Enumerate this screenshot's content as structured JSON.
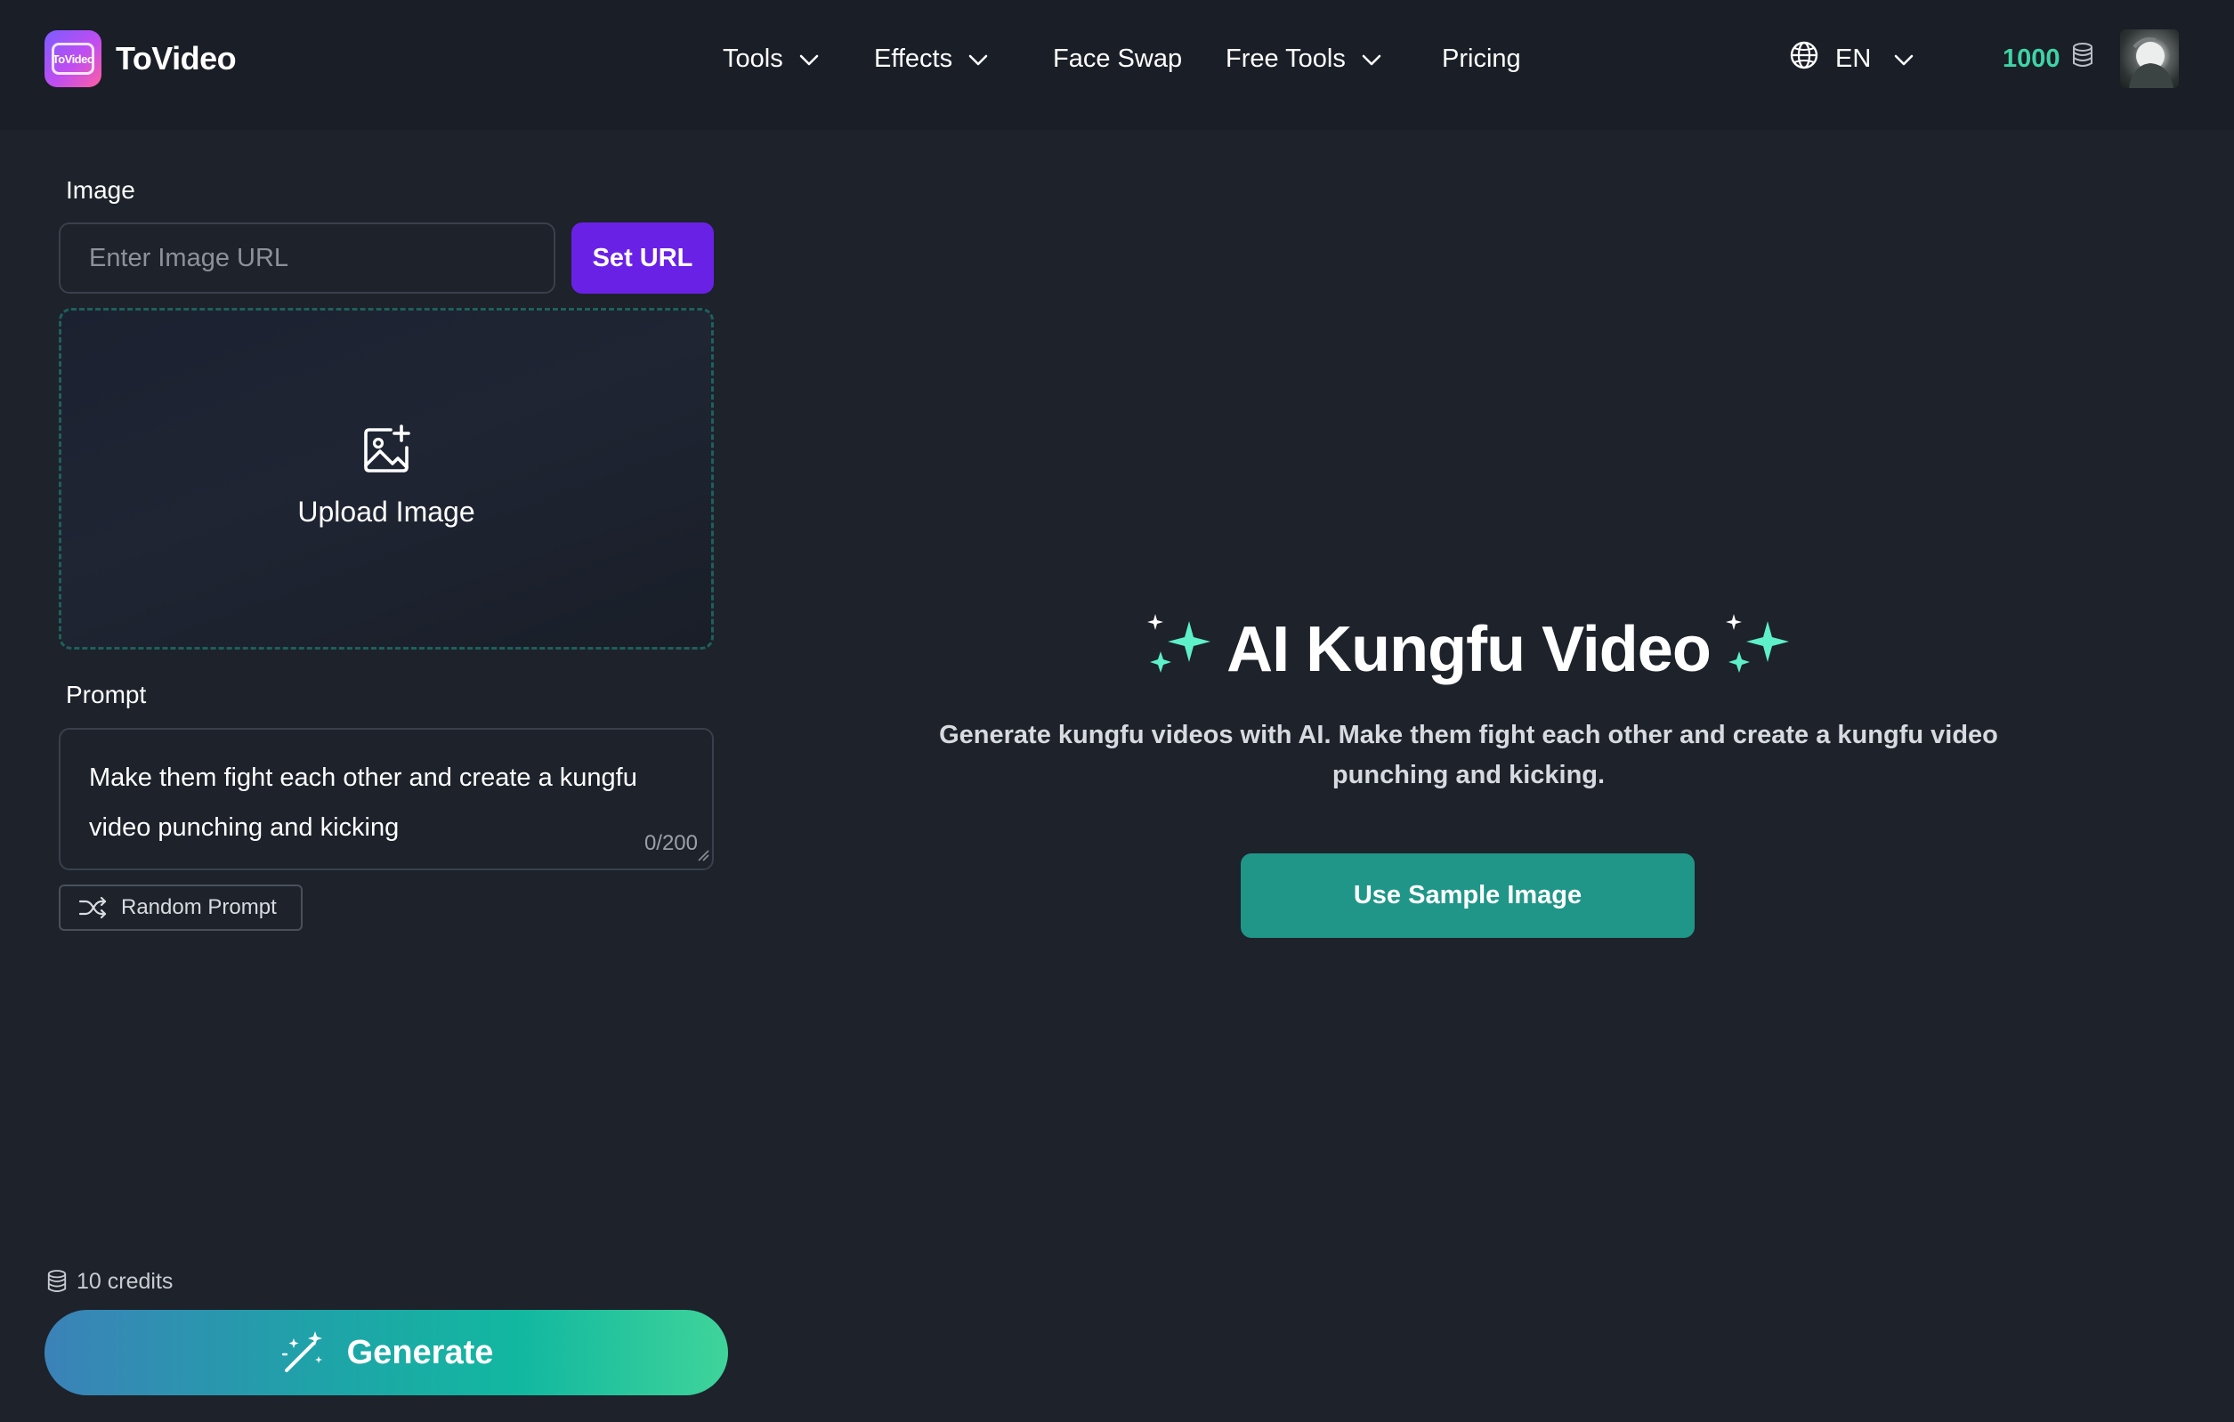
{
  "header": {
    "logo_text": "ToVideo",
    "brand": "ToVideo",
    "nav": [
      {
        "label": "Tools",
        "has_dropdown": true
      },
      {
        "label": "Effects",
        "has_dropdown": true
      },
      {
        "label": "Face Swap",
        "has_dropdown": false
      },
      {
        "label": "Free Tools",
        "has_dropdown": true
      },
      {
        "label": "Pricing",
        "has_dropdown": false
      }
    ],
    "language": "EN",
    "credits": "1000"
  },
  "form": {
    "image_label": "Image",
    "url_placeholder": "Enter Image URL",
    "url_value": "",
    "set_url_label": "Set URL",
    "upload_label": "Upload Image",
    "prompt_label": "Prompt",
    "prompt_value": "Make them fight each other and create a kungfu video punching and kicking",
    "char_count": "0/200",
    "random_prompt_label": "Random Prompt",
    "cost_label": "10 credits",
    "generate_label": "Generate"
  },
  "hero": {
    "title": "AI Kungfu Video",
    "description": "Generate kungfu videos with AI. Make them fight each other and create a kungfu video punching and kicking.",
    "sample_button_label": "Use Sample Image"
  },
  "colors": {
    "background": "#1d222b",
    "header_bg": "#1a1e26",
    "accent_purple": "#6a21e6",
    "accent_teal": "#1f9688",
    "credits_green": "#3fd3a6",
    "sparkle": "#5ef0c8"
  },
  "icons": {
    "logo": "tovideo-logo-icon",
    "chevron": "chevron-down-icon",
    "globe": "globe-icon",
    "coins": "coins-icon",
    "upload": "image-plus-icon",
    "shuffle": "shuffle-icon",
    "magic": "magic-wand-icon",
    "sparkles": "sparkles-icon"
  }
}
